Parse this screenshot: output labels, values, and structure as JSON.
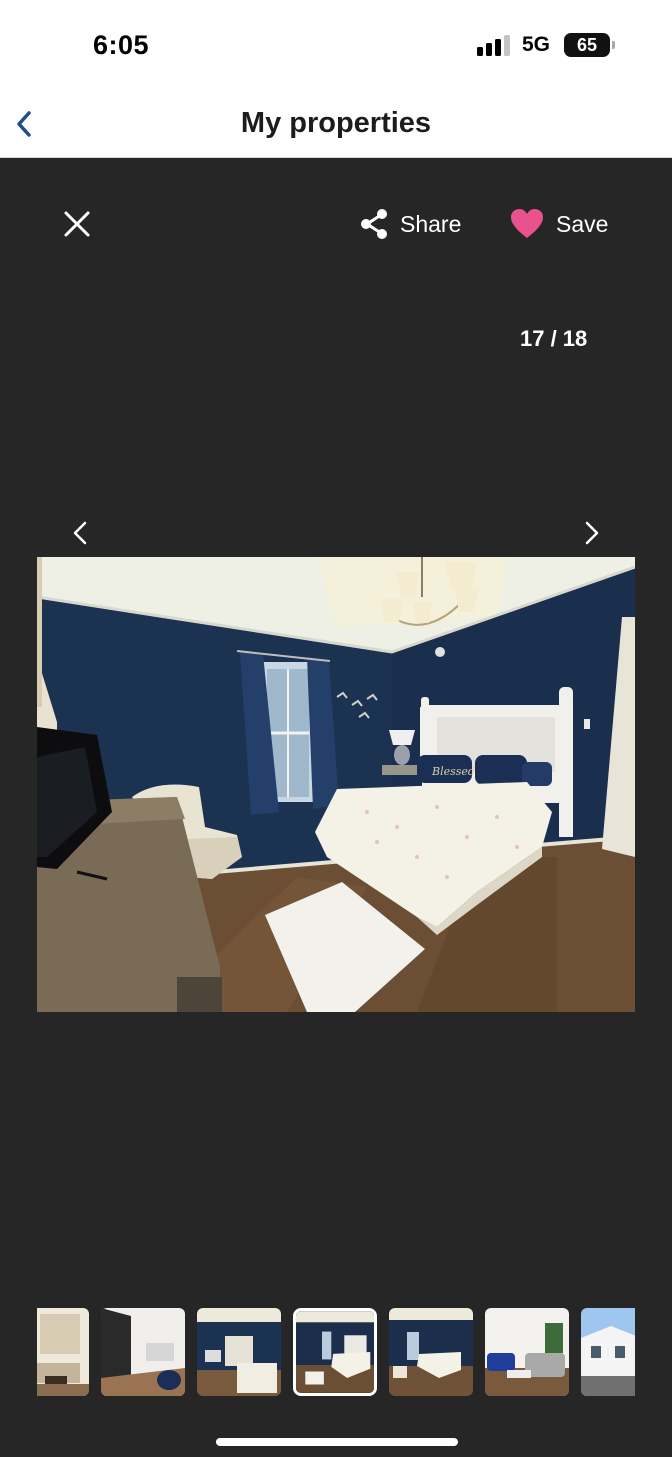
{
  "status_bar": {
    "time": "6:05",
    "network": "5G",
    "battery": "65"
  },
  "nav": {
    "title": "My properties",
    "back_icon": "chevron-left-icon"
  },
  "viewer": {
    "share_label": "Share",
    "save_label": "Save",
    "counter": "17 / 18",
    "close_icon": "close-icon",
    "share_icon": "share-icon",
    "save_icon": "heart-icon",
    "prev_icon": "chevron-left-icon",
    "next_icon": "chevron-right-icon"
  },
  "colors": {
    "accent_heart": "#e8538f",
    "back_chevron": "#1f4e8c",
    "viewer_bg": "#262626"
  },
  "photo": {
    "subject": "bedroom with navy blue walls, white bed, chandelier"
  },
  "thumbnails": {
    "count_visible": 7,
    "active_index": 3
  }
}
